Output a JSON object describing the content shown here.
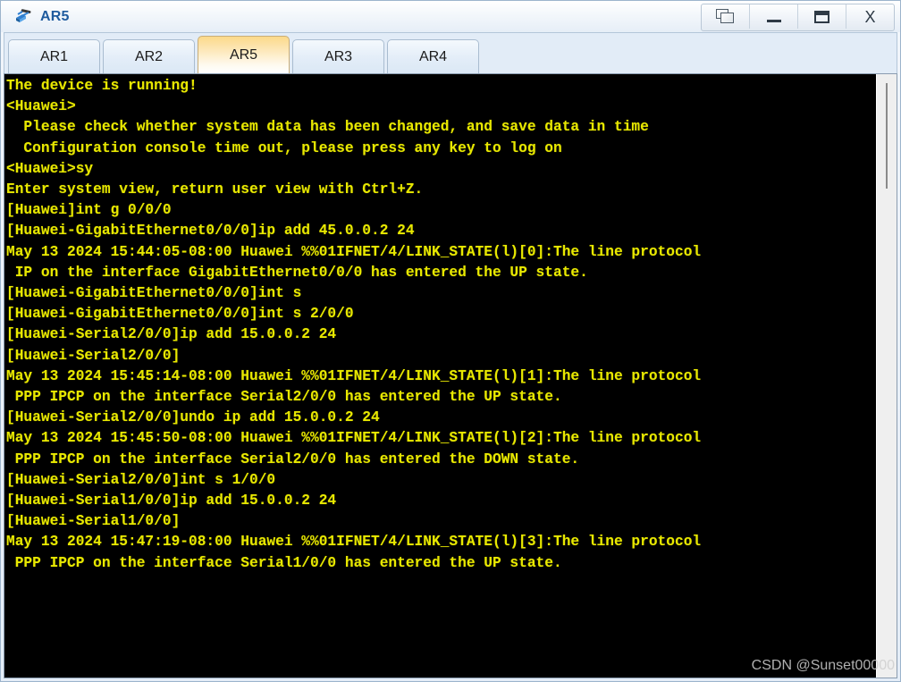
{
  "window": {
    "title": "AR5",
    "icon": "router-icon",
    "buttons": [
      {
        "name": "restore-window-button",
        "icon": "cascade-windows-icon",
        "label": ""
      },
      {
        "name": "minimize-button",
        "icon": "minimize-icon",
        "label": "_"
      },
      {
        "name": "maximize-button",
        "icon": "maximize-icon",
        "label": ""
      },
      {
        "name": "close-button",
        "icon": "close-icon",
        "label": "X"
      }
    ]
  },
  "tabs": [
    {
      "label": "AR1",
      "active": false
    },
    {
      "label": "AR2",
      "active": false
    },
    {
      "label": "AR5",
      "active": true
    },
    {
      "label": "AR3",
      "active": false
    },
    {
      "label": "AR4",
      "active": false
    }
  ],
  "terminal": {
    "foreground": "#e8e800",
    "background": "#000000",
    "lines": [
      "The device is running!",
      "",
      "<Huawei>",
      "",
      "  Please check whether system data has been changed, and save data in time",
      "",
      "  Configuration console time out, please press any key to log on",
      "",
      "<Huawei>sy",
      "Enter system view, return user view with Ctrl+Z.",
      "[Huawei]int g 0/0/0",
      "[Huawei-GigabitEthernet0/0/0]ip add 45.0.0.2 24",
      "May 13 2024 15:44:05-08:00 Huawei %%01IFNET/4/LINK_STATE(l)[0]:The line protocol",
      " IP on the interface GigabitEthernet0/0/0 has entered the UP state.",
      "[Huawei-GigabitEthernet0/0/0]int s",
      "[Huawei-GigabitEthernet0/0/0]int s 2/0/0",
      "[Huawei-Serial2/0/0]ip add 15.0.0.2 24",
      "[Huawei-Serial2/0/0]",
      "May 13 2024 15:45:14-08:00 Huawei %%01IFNET/4/LINK_STATE(l)[1]:The line protocol",
      " PPP IPCP on the interface Serial2/0/0 has entered the UP state.",
      "[Huawei-Serial2/0/0]undo ip add 15.0.0.2 24",
      "May 13 2024 15:45:50-08:00 Huawei %%01IFNET/4/LINK_STATE(l)[2]:The line protocol",
      " PPP IPCP on the interface Serial2/0/0 has entered the DOWN state.",
      "[Huawei-Serial2/0/0]int s 1/0/0",
      "[Huawei-Serial1/0/0]ip add 15.0.0.2 24",
      "[Huawei-Serial1/0/0]",
      "May 13 2024 15:47:19-08:00 Huawei %%01IFNET/4/LINK_STATE(l)[3]:The line protocol",
      " PPP IPCP on the interface Serial1/0/0 has entered the UP state."
    ]
  },
  "watermark": {
    "text": "CSDN @Sunset00000"
  }
}
